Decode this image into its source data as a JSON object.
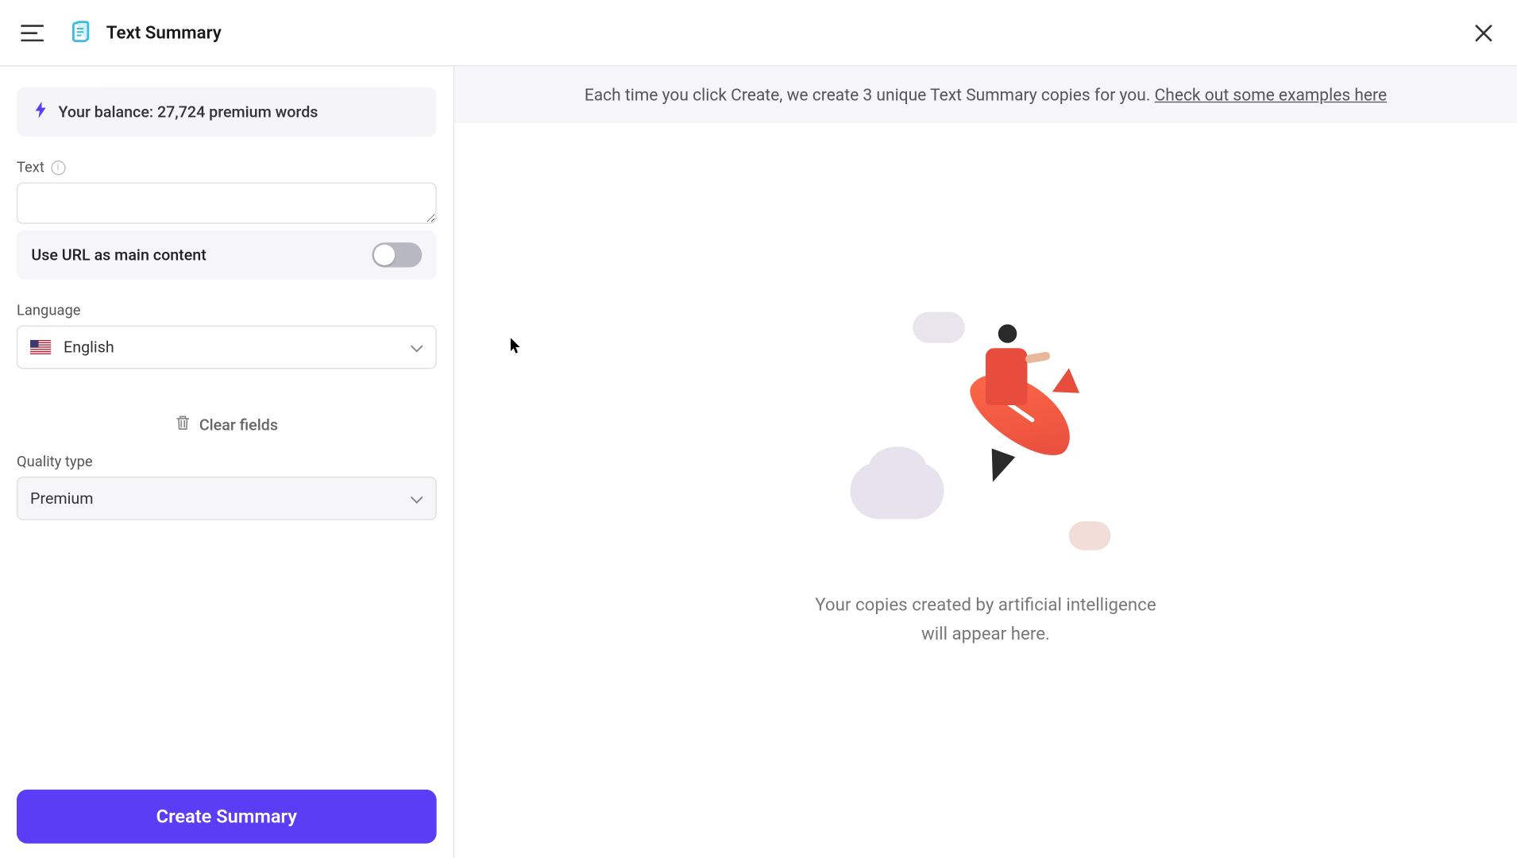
{
  "header": {
    "title": "Text Summary"
  },
  "sidebar": {
    "balance_label": "Your balance: 27,724 premium words",
    "text_label": "Text",
    "text_value": "",
    "url_toggle_label": "Use URL as main content",
    "url_toggle_on": false,
    "language_label": "Language",
    "language_value": "English",
    "clear_label": "Clear fields",
    "quality_label": "Quality type",
    "quality_value": "Premium",
    "create_button": "Create Summary"
  },
  "main": {
    "banner_text": "Each time you click Create, we create 3 unique Text Summary copies for you. ",
    "banner_link": "Check out some examples here",
    "empty_line1": "Your copies created by artificial intelligence",
    "empty_line2": "will appear here."
  },
  "icons": {
    "bolt": "bolt-icon",
    "info": "info-icon",
    "trash": "trash-icon",
    "chevron": "chevron-down-icon",
    "close": "close-icon",
    "hamburger": "hamburger-icon",
    "logo": "document-icon",
    "flag": "us-flag-icon"
  },
  "colors": {
    "accent": "#5b3df5",
    "rocket": "#e74c3c"
  }
}
